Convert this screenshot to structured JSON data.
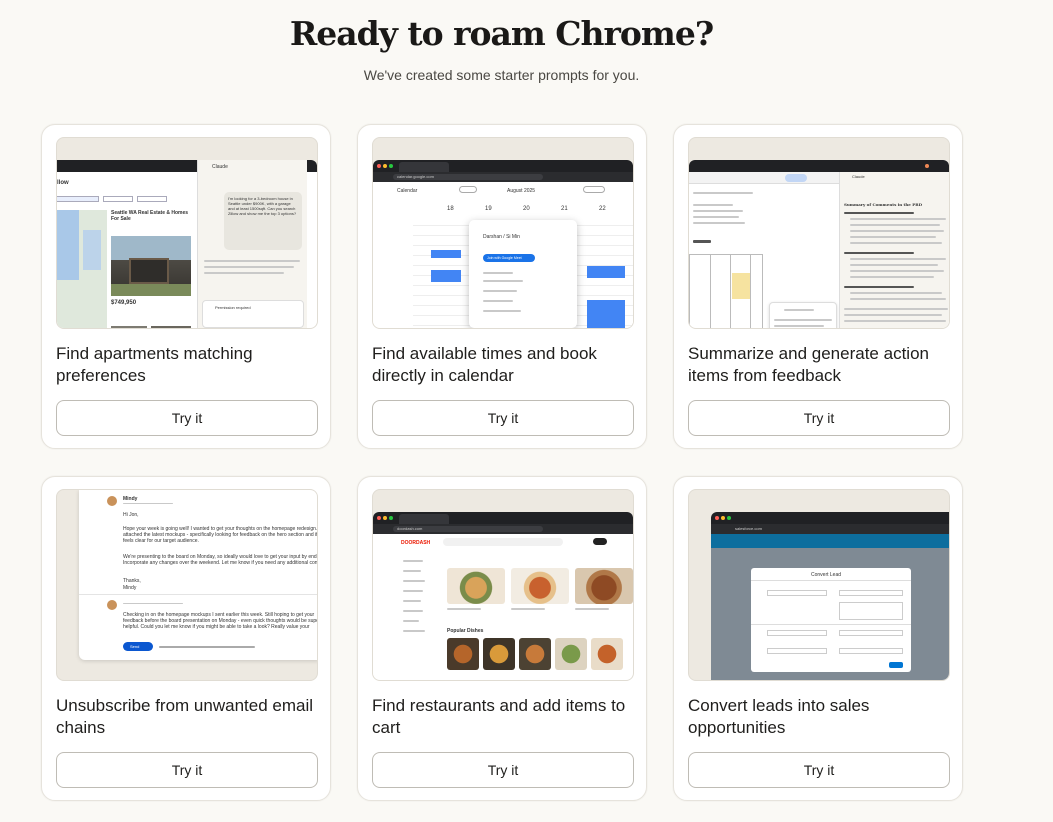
{
  "header": {
    "title": "Ready to roam Chrome?",
    "subtitle": "We've created some starter prompts for you."
  },
  "cards": [
    {
      "title": "Find apartments matching preferences",
      "button": "Try it",
      "thumb": {
        "listing_title": "Seattle WA Real Estate & Homes For Sale",
        "price": "$749,950",
        "chat_message": "I'm looking for a 3-bedroom house in Seattle under $900K, with a garage and at least 1500sqft. Can you search Zillow and show me the top 3 options?",
        "panel_title": "Claude",
        "permission": "Permission required"
      }
    },
    {
      "title": "Find available times and book directly in calendar",
      "button": "Try it",
      "thumb": {
        "app": "Calendar",
        "month": "August 2025",
        "days": [
          "18",
          "19",
          "20",
          "21",
          "22"
        ],
        "event_title": "Darshan / Si Min",
        "join_label": "Join with Google Meet",
        "url": "calendar.google.com"
      }
    },
    {
      "title": "Summarize and generate action items from feedback",
      "button": "Try it",
      "thumb": {
        "doc_heading": "Summary of Comments in the PRD",
        "panel_title": "Claude"
      }
    },
    {
      "title": "Unsubscribe from unwanted email chains",
      "button": "Try it",
      "thumb": {
        "sender": "Mindy",
        "greeting": "Hi Jon,",
        "body": "Hope your week is going well! I wanted to get your thoughts on the homepage redesign. I've attached the latest mockups - specifically looking for feedback on the hero section and if it feels clear for our target audience.",
        "body2": "We're presenting to the board on Monday, so ideally would love to get your input by end of day. Incorporate any changes over the weekend. Let me know if you need any additional context!",
        "signoff": "Thanks,",
        "signname": "Mindy",
        "reply": "Checking in on the homepage mockups I sent earlier this week. Still hoping to get your feedback before the board presentation on Monday - even quick thoughts would be super helpful. Could you let me know if you might be able to take a look? Really value your perspective on this!",
        "send_label": "Send"
      }
    },
    {
      "title": "Find restaurants and add items to cart",
      "button": "Try it",
      "thumb": {
        "brand": "DOORDASH",
        "section": "Popular Dishes",
        "url": "doordash.com"
      }
    },
    {
      "title": "Convert leads into sales opportunities",
      "button": "Try it",
      "thumb": {
        "dialog_title": "Convert Lead",
        "url": "salesforce.com"
      }
    }
  ]
}
